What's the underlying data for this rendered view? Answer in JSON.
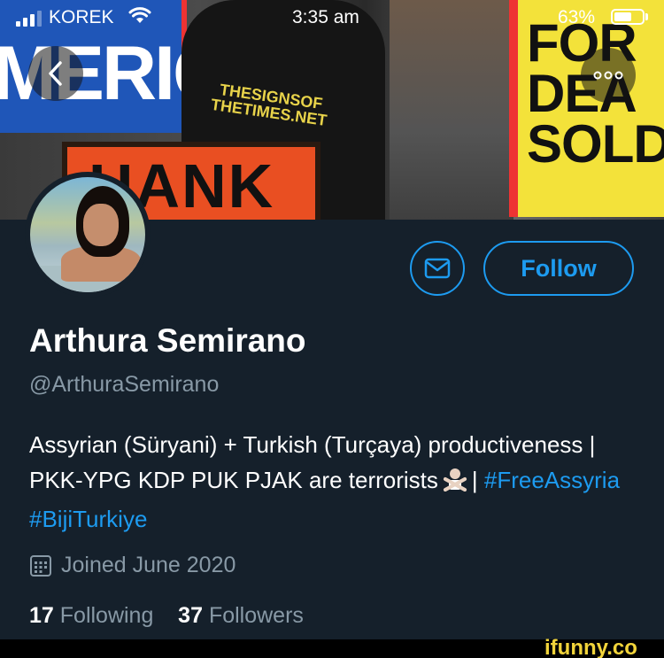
{
  "status_bar": {
    "carrier": "KOREK",
    "time": "3:35 am",
    "battery_percent": "63%",
    "battery_level": 0.63,
    "signal_bars": 3
  },
  "banner": {
    "sign_left_text": "MERICA",
    "shirt_text": "THESIGNSOF THETIMES.NET",
    "sign_bottom_text": "HANK",
    "sign_right_text": "FOR DEA SOLDIE"
  },
  "nav": {
    "back_icon": "chevron-left-icon",
    "more_icon": "ellipsis-icon"
  },
  "profile": {
    "name": "Arthura Semirano",
    "handle": "@ArthuraSemirano",
    "bio_part1": "Assyrian (Süryani) + Turkish (Turçaya) productiveness | PKK-YPG KDP PUK PJAK are terrorists",
    "bio_separator": "|",
    "hashtag1": "#FreeAssyria",
    "hashtag2": "#BijiTurkiye",
    "joined": "Joined June 2020",
    "following_count": "17",
    "following_label": "Following",
    "followers_count": "37",
    "followers_label": "Followers"
  },
  "actions": {
    "message_icon": "envelope-icon",
    "follow_label": "Follow"
  },
  "watermark": "ifunny.co",
  "colors": {
    "background": "#15202b",
    "accent": "#1d9bf0",
    "muted": "#8899a6"
  }
}
